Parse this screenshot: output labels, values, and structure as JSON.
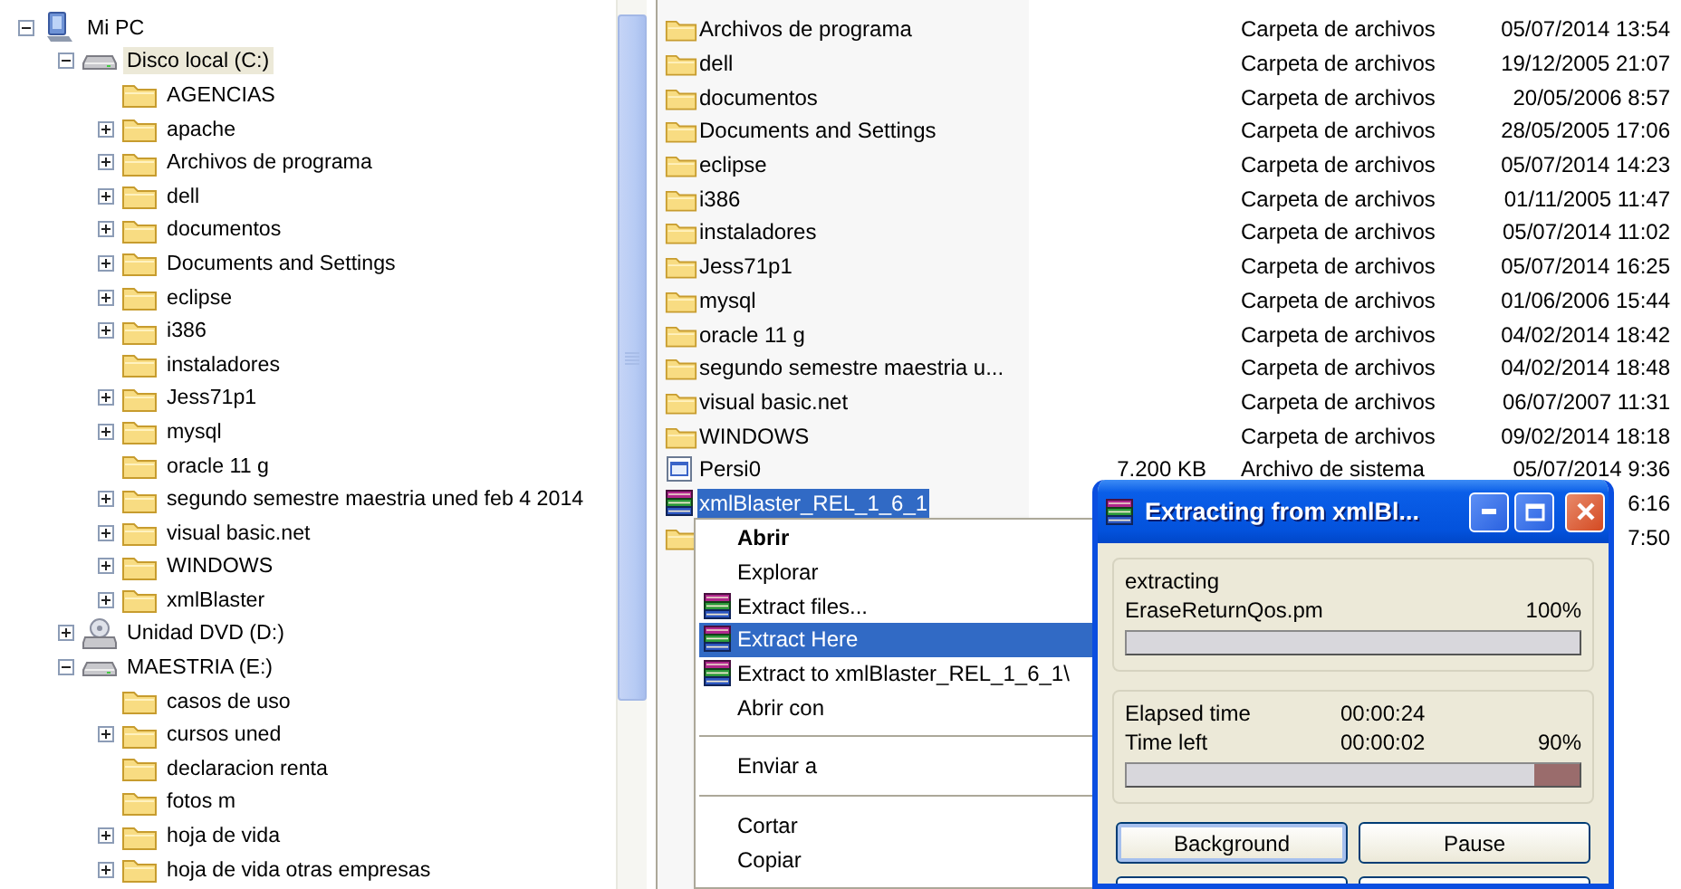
{
  "tree": [
    {
      "label": "Mi PC",
      "kind": "computer",
      "has_children": true,
      "expanded": true,
      "selected": false,
      "children": [
        {
          "label": "Disco local (C:)",
          "kind": "drive",
          "has_children": true,
          "expanded": true,
          "selected": true,
          "children": [
            {
              "label": "AGENCIAS",
              "kind": "folder",
              "has_children": false,
              "selected": false
            },
            {
              "label": "apache",
              "kind": "folder",
              "has_children": true,
              "expanded": false,
              "selected": false
            },
            {
              "label": "Archivos de programa",
              "kind": "folder",
              "has_children": true,
              "expanded": false,
              "selected": false
            },
            {
              "label": "dell",
              "kind": "folder",
              "has_children": true,
              "expanded": false,
              "selected": false
            },
            {
              "label": "documentos",
              "kind": "folder",
              "has_children": true,
              "expanded": false,
              "selected": false
            },
            {
              "label": "Documents and Settings",
              "kind": "folder",
              "has_children": true,
              "expanded": false,
              "selected": false
            },
            {
              "label": "eclipse",
              "kind": "folder",
              "has_children": true,
              "expanded": false,
              "selected": false
            },
            {
              "label": "i386",
              "kind": "folder",
              "has_children": true,
              "expanded": false,
              "selected": false
            },
            {
              "label": "instaladores",
              "kind": "folder",
              "has_children": false,
              "selected": false
            },
            {
              "label": "Jess71p1",
              "kind": "folder",
              "has_children": true,
              "expanded": false,
              "selected": false
            },
            {
              "label": "mysql",
              "kind": "folder",
              "has_children": true,
              "expanded": false,
              "selected": false
            },
            {
              "label": "oracle 11 g",
              "kind": "folder",
              "has_children": false,
              "selected": false
            },
            {
              "label": "segundo semestre maestria uned feb 4 2014",
              "kind": "folder",
              "has_children": true,
              "expanded": false,
              "selected": false
            },
            {
              "label": "visual basic.net",
              "kind": "folder",
              "has_children": true,
              "expanded": false,
              "selected": false
            },
            {
              "label": "WINDOWS",
              "kind": "folder",
              "has_children": true,
              "expanded": false,
              "selected": false
            },
            {
              "label": "xmlBlaster",
              "kind": "folder",
              "has_children": true,
              "expanded": false,
              "selected": false
            }
          ]
        },
        {
          "label": "Unidad DVD (D:)",
          "kind": "dvd",
          "has_children": true,
          "expanded": false,
          "selected": false
        },
        {
          "label": "MAESTRIA (E:)",
          "kind": "drive",
          "has_children": true,
          "expanded": true,
          "selected": false,
          "children": [
            {
              "label": "casos de uso",
              "kind": "folder",
              "has_children": false,
              "selected": false
            },
            {
              "label": "cursos uned",
              "kind": "folder",
              "has_children": true,
              "expanded": false,
              "selected": false
            },
            {
              "label": "declaracion renta",
              "kind": "folder",
              "has_children": false,
              "selected": false
            },
            {
              "label": "fotos m",
              "kind": "folder",
              "has_children": false,
              "selected": false
            },
            {
              "label": "hoja de vida",
              "kind": "folder",
              "has_children": true,
              "expanded": false,
              "selected": false
            },
            {
              "label": "hoja de vida otras empresas",
              "kind": "folder",
              "has_children": true,
              "expanded": false,
              "selected": false
            }
          ]
        }
      ]
    }
  ],
  "files": [
    {
      "name": "Archivos de programa",
      "kind": "folder",
      "type": "Carpeta de archivos",
      "date": "05/07/2014 13:54",
      "selected": false
    },
    {
      "name": "dell",
      "kind": "folder",
      "type": "Carpeta de archivos",
      "date": "19/12/2005 21:07",
      "selected": false
    },
    {
      "name": "documentos",
      "kind": "folder",
      "type": "Carpeta de archivos",
      "date": "20/05/2006 8:57",
      "selected": false
    },
    {
      "name": "Documents and Settings",
      "kind": "folder",
      "type": "Carpeta de archivos",
      "date": "28/05/2005 17:06",
      "selected": false
    },
    {
      "name": "eclipse",
      "kind": "folder",
      "type": "Carpeta de archivos",
      "date": "05/07/2014 14:23",
      "selected": false
    },
    {
      "name": "i386",
      "kind": "folder",
      "type": "Carpeta de archivos",
      "date": "01/11/2005 11:47",
      "selected": false
    },
    {
      "name": "instaladores",
      "kind": "folder",
      "type": "Carpeta de archivos",
      "date": "05/07/2014 11:02",
      "selected": false
    },
    {
      "name": "Jess71p1",
      "kind": "folder",
      "type": "Carpeta de archivos",
      "date": "05/07/2014 16:25",
      "selected": false
    },
    {
      "name": "mysql",
      "kind": "folder",
      "type": "Carpeta de archivos",
      "date": "01/06/2006 15:44",
      "selected": false
    },
    {
      "name": "oracle 11 g",
      "kind": "folder",
      "type": "Carpeta de archivos",
      "date": "04/02/2014 18:42",
      "selected": false
    },
    {
      "name": "segundo semestre maestria u...",
      "kind": "folder",
      "type": "Carpeta de archivos",
      "date": "04/02/2014 18:48",
      "selected": false
    },
    {
      "name": "visual basic.net",
      "kind": "folder",
      "type": "Carpeta de archivos",
      "date": "06/07/2007 11:31",
      "selected": false
    },
    {
      "name": "WINDOWS",
      "kind": "folder",
      "type": "Carpeta de archivos",
      "date": "09/02/2014 18:18",
      "selected": false
    },
    {
      "name": "Persi0",
      "kind": "system",
      "size": "7.200 KB",
      "type": "Archivo de sistema",
      "date": "05/07/2014 9:36",
      "selected": false
    },
    {
      "name": "xmlBlaster_REL_1_6_1",
      "kind": "archive",
      "date": "6:16",
      "selected": true
    },
    {
      "kind": "folder",
      "date": "7:50"
    }
  ],
  "context_menu": [
    {
      "kind": "item",
      "label": "Abrir",
      "bold": true,
      "icon": false,
      "selected": false
    },
    {
      "kind": "item",
      "label": "Explorar",
      "bold": false,
      "icon": false,
      "selected": false
    },
    {
      "kind": "item",
      "label": "Extract files...",
      "bold": false,
      "icon": true,
      "selected": false
    },
    {
      "kind": "item",
      "label": "Extract Here",
      "bold": false,
      "icon": true,
      "selected": true
    },
    {
      "kind": "item",
      "label": "Extract to xmlBlaster_REL_1_6_1\\",
      "bold": false,
      "icon": true,
      "selected": false
    },
    {
      "kind": "item",
      "label": "Abrir con",
      "bold": false,
      "icon": false,
      "selected": false
    },
    {
      "kind": "separator"
    },
    {
      "kind": "item",
      "label": "Enviar a",
      "bold": false,
      "icon": false,
      "selected": false
    },
    {
      "kind": "separator"
    },
    {
      "kind": "item",
      "label": "Cortar",
      "bold": false,
      "icon": false,
      "selected": false
    },
    {
      "kind": "item",
      "label": "Copiar",
      "bold": false,
      "icon": false,
      "selected": false
    },
    {
      "kind": "separator"
    }
  ],
  "dialog": {
    "title": "Extracting from xmlBl...",
    "action": "extracting",
    "file": "EraseReturnQos.pm",
    "file_percent": "100%",
    "file_progress": {
      "level": 1
    },
    "elapsed_label": "Elapsed time",
    "elapsed": "00:00:24",
    "left_label": "Time left",
    "left": "00:00:02",
    "total_percent": "90%",
    "total_progress": {
      "level": 0.9
    },
    "buttons": [
      {
        "label": "Background",
        "focused": true
      },
      {
        "label": "Pause",
        "focused": false
      },
      {
        "focused": false
      },
      {
        "focused": false
      }
    ]
  }
}
